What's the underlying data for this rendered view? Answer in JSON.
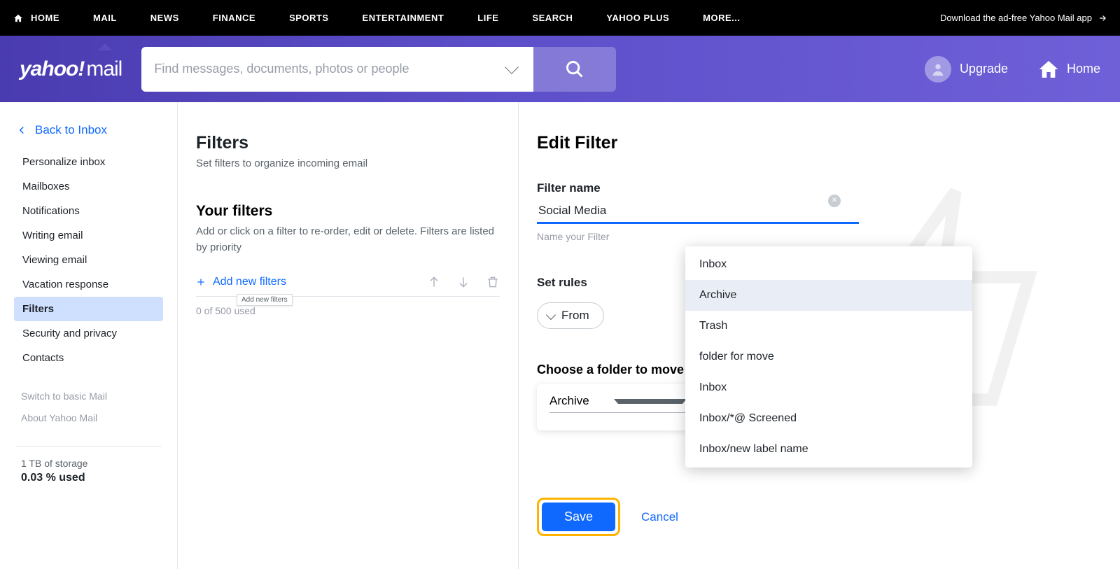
{
  "topnav": {
    "items": [
      "HOME",
      "MAIL",
      "NEWS",
      "FINANCE",
      "SPORTS",
      "ENTERTAINMENT",
      "LIFE",
      "SEARCH",
      "YAHOO PLUS",
      "MORE..."
    ],
    "active_index": 1,
    "download": "Download the ad-free Yahoo Mail app"
  },
  "header": {
    "logo_main": "yahoo!",
    "logo_sub": "mail",
    "search_placeholder": "Find messages, documents, photos or people",
    "upgrade": "Upgrade",
    "home": "Home"
  },
  "sidebar": {
    "back": "Back to Inbox",
    "items": [
      "Personalize inbox",
      "Mailboxes",
      "Notifications",
      "Writing email",
      "Viewing email",
      "Vacation response",
      "Filters",
      "Security and privacy",
      "Contacts"
    ],
    "selected_index": 6,
    "minor": [
      "Switch to basic Mail",
      "About Yahoo Mail"
    ],
    "storage_line": "1 TB of storage",
    "storage_pct": "0.03 % used"
  },
  "filters_panel": {
    "title": "Filters",
    "subtitle": "Set filters to organize incoming email",
    "your_filters": "Your filters",
    "your_filters_sub": "Add or click on a filter to re-order, edit or delete. Filters are listed by priority",
    "add_new": "Add new filters",
    "tooltip": "Add new filters",
    "used": "0 of 500 used"
  },
  "edit_panel": {
    "title": "Edit Filter",
    "name_label": "Filter name",
    "name_value": "Social Media",
    "name_helper": "Name your Filter",
    "rules_label": "Set rules",
    "rule_pill": "From",
    "choose_label": "Choose a folder to move to",
    "selected_folder": "Archive",
    "save": "Save",
    "cancel": "Cancel"
  },
  "folder_dropdown": {
    "options": [
      "Inbox",
      "Archive",
      "Trash",
      "folder for move",
      "Inbox",
      "Inbox/*@ Screened",
      "Inbox/new label name"
    ],
    "highlight_index": 1
  }
}
